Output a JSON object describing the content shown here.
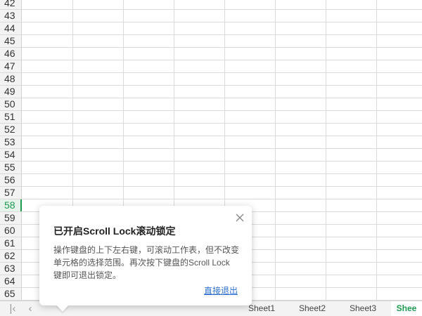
{
  "grid": {
    "rows": [
      {
        "label": "42"
      },
      {
        "label": "43"
      },
      {
        "label": "44"
      },
      {
        "label": "45"
      },
      {
        "label": "46"
      },
      {
        "label": "47"
      },
      {
        "label": "48"
      },
      {
        "label": "49"
      },
      {
        "label": "50"
      },
      {
        "label": "51"
      },
      {
        "label": "52"
      },
      {
        "label": "53"
      },
      {
        "label": "54"
      },
      {
        "label": "55"
      },
      {
        "label": "56"
      },
      {
        "label": "57"
      },
      {
        "label": "58",
        "active": true
      },
      {
        "label": "59"
      },
      {
        "label": "60"
      },
      {
        "label": "61"
      },
      {
        "label": "62"
      },
      {
        "label": "63"
      },
      {
        "label": "64"
      },
      {
        "label": "65"
      }
    ]
  },
  "tabbar": {
    "nav": [
      {
        "icon": "first-sheet-icon",
        "glyph": "|‹"
      },
      {
        "icon": "prev-sheet-icon",
        "glyph": "‹"
      }
    ],
    "tabs": [
      {
        "label": "Sheet1",
        "active": false
      },
      {
        "label": "Sheet2",
        "active": false
      },
      {
        "label": "Sheet3",
        "active": false
      },
      {
        "label": "Shee",
        "active": true
      }
    ]
  },
  "popup": {
    "title": "已开启Scroll Lock滚动锁定",
    "body_lines": [
      "操作键盘的上下左右键，可滚动工作表，但不改变",
      "单元格的选择范围。再次按下键盘的Scroll Lock",
      "键即可退出锁定。"
    ],
    "link": "直接退出",
    "close_icon": "close-icon"
  },
  "colors": {
    "accent": "#1e9a52",
    "link": "#2f6fd1",
    "grid_line": "#dadada"
  }
}
